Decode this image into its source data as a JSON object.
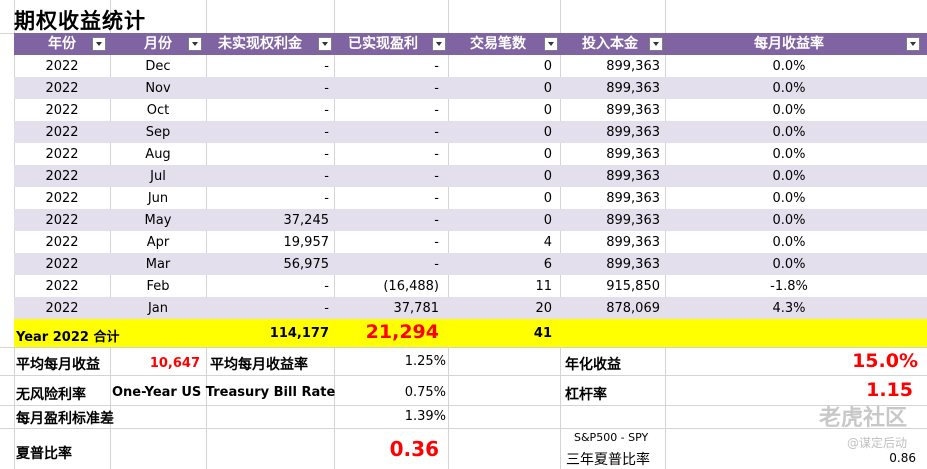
{
  "title": "期权收益统计",
  "headers": [
    "年份",
    "月份",
    "未实现权利金",
    "已实现盈利",
    "交易笔数",
    "投入本金",
    "每月收益率"
  ],
  "rows": [
    {
      "year": "2022",
      "month": "Dec",
      "unrealized": "-",
      "realized": "-",
      "trades": "0",
      "capital": "899,363",
      "rate": "0.0%"
    },
    {
      "year": "2022",
      "month": "Nov",
      "unrealized": "-",
      "realized": "-",
      "trades": "0",
      "capital": "899,363",
      "rate": "0.0%"
    },
    {
      "year": "2022",
      "month": "Oct",
      "unrealized": "-",
      "realized": "-",
      "trades": "0",
      "capital": "899,363",
      "rate": "0.0%"
    },
    {
      "year": "2022",
      "month": "Sep",
      "unrealized": "-",
      "realized": "-",
      "trades": "0",
      "capital": "899,363",
      "rate": "0.0%"
    },
    {
      "year": "2022",
      "month": "Aug",
      "unrealized": "-",
      "realized": "-",
      "trades": "0",
      "capital": "899,363",
      "rate": "0.0%"
    },
    {
      "year": "2022",
      "month": "Jul",
      "unrealized": "-",
      "realized": "-",
      "trades": "0",
      "capital": "899,363",
      "rate": "0.0%"
    },
    {
      "year": "2022",
      "month": "Jun",
      "unrealized": "-",
      "realized": "-",
      "trades": "0",
      "capital": "899,363",
      "rate": "0.0%"
    },
    {
      "year": "2022",
      "month": "May",
      "unrealized": "37,245",
      "realized": "-",
      "trades": "0",
      "capital": "899,363",
      "rate": "0.0%"
    },
    {
      "year": "2022",
      "month": "Apr",
      "unrealized": "19,957",
      "realized": "-",
      "trades": "4",
      "capital": "899,363",
      "rate": "0.0%"
    },
    {
      "year": "2022",
      "month": "Mar",
      "unrealized": "56,975",
      "realized": "-",
      "trades": "6",
      "capital": "899,363",
      "rate": "0.0%"
    },
    {
      "year": "2022",
      "month": "Feb",
      "unrealized": "-",
      "realized": "(16,488)",
      "trades": "11",
      "capital": "915,850",
      "rate": "-1.8%"
    },
    {
      "year": "2022",
      "month": "Jan",
      "unrealized": "-",
      "realized": "37,781",
      "trades": "20",
      "capital": "878,069",
      "rate": "4.3%"
    }
  ],
  "total": {
    "label": "Year 2022 合计",
    "unrealized": "114,177",
    "realized": "21,294",
    "trades": "41"
  },
  "summary": {
    "avg_monthly_label": "平均每月收益",
    "avg_monthly_value": "10,647",
    "avg_monthly_rate_label": "平均每月收益率",
    "avg_monthly_rate_value": "1.25%",
    "annual_label": "年化收益",
    "annual_value": "15.0%",
    "riskfree_label": "无风险利率",
    "riskfree_desc": "One-Year US Treasury Bill Rate",
    "riskfree_value": "0.75%",
    "leverage_label": "杠杆率",
    "leverage_value": "1.15",
    "stdev_label": "每月盈利标准差",
    "stdev_value": "1.39%",
    "sharpe_label": "夏普比率",
    "sharpe_value": "0.36",
    "spy_label": "S&P500 - SPY",
    "spy_sharpe_label": "三年夏普比率",
    "spy_sharpe_value": "0.86"
  },
  "watermark": "老虎社区",
  "watermark_sub": "@谋定后动"
}
